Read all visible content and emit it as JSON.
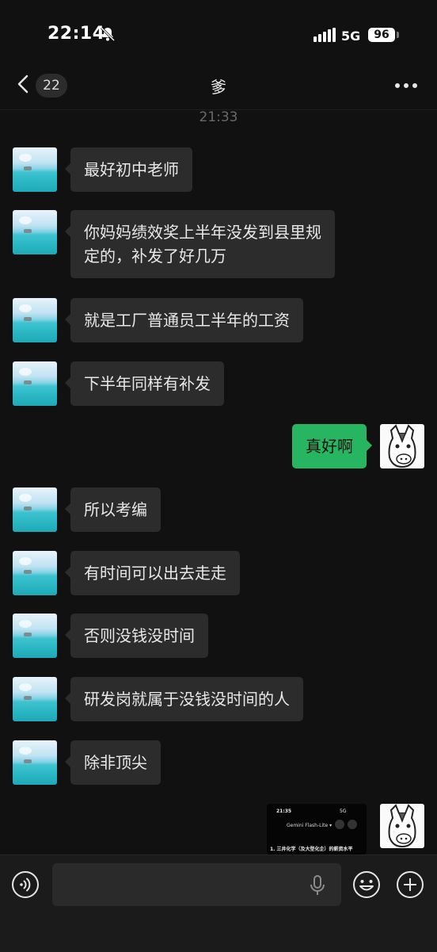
{
  "status_bar": {
    "time": "22:14",
    "network": "5G",
    "battery": "96"
  },
  "nav": {
    "unread_count": "22",
    "title": "爹"
  },
  "timestamp": "21:33",
  "messages": [
    {
      "text": "最好初中老师"
    },
    {
      "text": "你妈妈绩效奖上半年没发到县里规\n定的，补发了好几万"
    },
    {
      "text": "就是工厂普通员工半年的工资"
    },
    {
      "text": "下半年同样有补发"
    },
    {
      "text": "真好啊"
    },
    {
      "text": "所以考编"
    },
    {
      "text": "有时间可以出去走走"
    },
    {
      "text": "否则没钱没时间"
    },
    {
      "text": "研发岗就属于没钱没时间的人"
    },
    {
      "text": "除非顶尖"
    }
  ],
  "screenshot_thumb": {
    "time": "21:35",
    "signal": "5G",
    "app": "Gemini Flash-Lite ▾",
    "line": "1. 三井化学（及大型化企）的薪资水平"
  },
  "colors": {
    "background": "#111111",
    "bubble_other": "#2c2c2c",
    "bubble_self": "#28b561",
    "input_bar": "#1b1b1b"
  },
  "icons": [
    "bell-off-icon",
    "signal-icon",
    "back-icon",
    "more-icon",
    "voice-icon",
    "mic-icon",
    "emoji-icon",
    "plus-icon"
  ]
}
